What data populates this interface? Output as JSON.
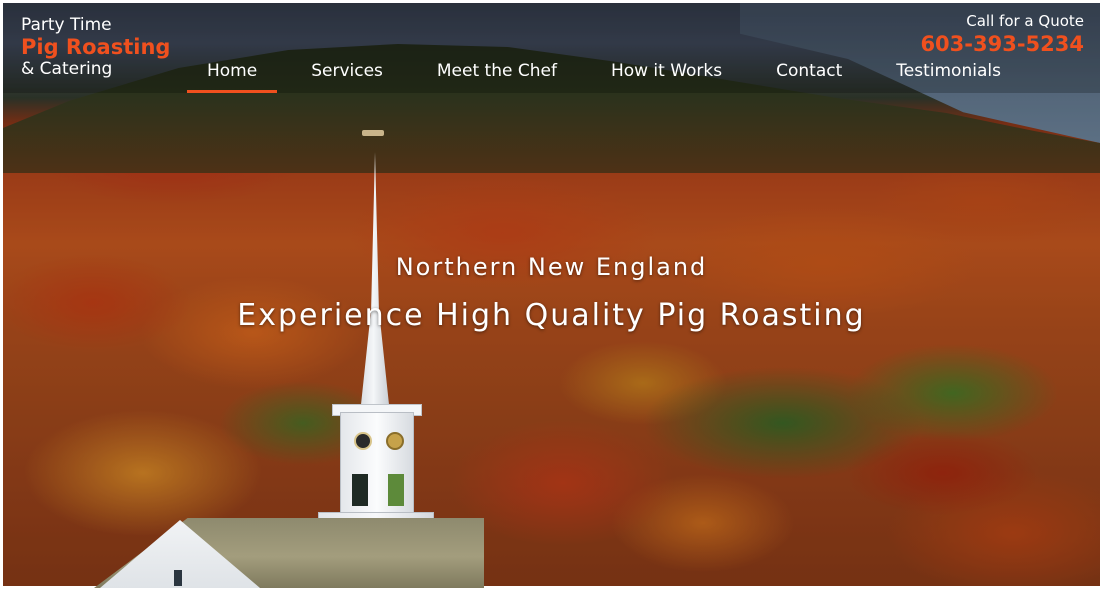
{
  "brand": {
    "line1": "Party Time",
    "line2": "Pig Roasting",
    "line3": "& Catering",
    "accent_color": "#f0501e"
  },
  "nav": {
    "items": [
      {
        "label": "Home",
        "active": true
      },
      {
        "label": "Services",
        "active": false
      },
      {
        "label": "Meet the Chef",
        "active": false
      },
      {
        "label": "How it Works",
        "active": false
      },
      {
        "label": "Contact",
        "active": false
      },
      {
        "label": "Testimonials",
        "active": false
      }
    ]
  },
  "quote": {
    "label": "Call for a Quote",
    "phone": "603-393-5234"
  },
  "hero": {
    "subtitle": "Northern New England",
    "title": "Experience High Quality Pig Roasting"
  }
}
